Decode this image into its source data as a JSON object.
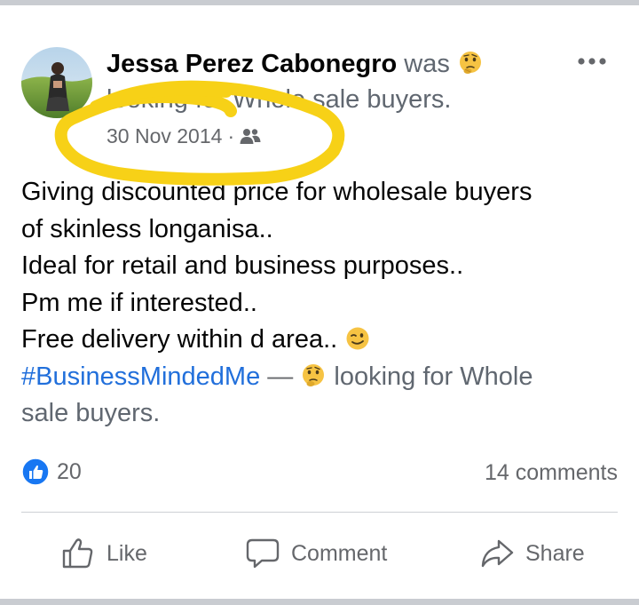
{
  "post": {
    "author": "Jessa Perez Cabonegro",
    "status_verb": "was",
    "feeling_text": "looking for Whole sale buyers.",
    "date": "30 Nov 2014",
    "separator": "·",
    "audience_icon": "friends-icon",
    "feeling_icon": "thinking-face-emoji",
    "body_lines": [
      "Giving discounted price for wholesale buyers",
      "of skinless longanisa..",
      "Ideal for retail and business purposes..",
      "Pm me if interested..",
      "Free delivery within d area.."
    ],
    "wink_icon": "winking-face-emoji",
    "hashtag": "#BusinessMindedMe",
    "dash": "—",
    "feeling_repeat_line1": "looking for Whole",
    "feeling_repeat_line2": "sale buyers.",
    "reactions": {
      "icon": "like-badge-icon",
      "count": "20"
    },
    "comments": "14 comments"
  },
  "actions": {
    "like": "Like",
    "comment": "Comment",
    "share": "Share"
  },
  "colors": {
    "hashtag": "#216fdb",
    "like_blue": "#1877f2",
    "highlight": "#f7d117",
    "secondary_text": "#65676b"
  }
}
